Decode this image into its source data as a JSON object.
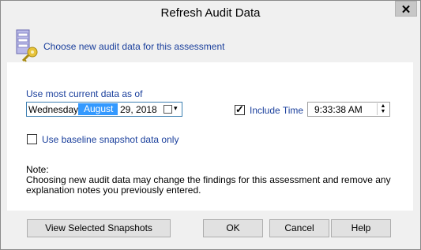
{
  "window": {
    "title": "Refresh Audit Data",
    "close_glyph": "✕"
  },
  "header": {
    "text": "Choose new audit data for this assessment",
    "icon": "database-key-icon"
  },
  "date_section": {
    "label": "Use most current data as of",
    "day": "Wednesday,",
    "month": "August",
    "day_year": "29, 2018",
    "dropdown_glyph": "▾"
  },
  "time_section": {
    "include_label": "Include Time",
    "include_checked": true,
    "value": "9:33:38 AM"
  },
  "baseline": {
    "label": "Use baseline snapshot data only",
    "checked": false
  },
  "note": {
    "heading": "Note:",
    "line1": "Choosing new audit data may change the findings for this assessment and remove any",
    "line2": "explanation notes you previously entered."
  },
  "buttons": {
    "view_snapshots": "View Selected Snapshots",
    "ok": "OK",
    "cancel": "Cancel",
    "help": "Help"
  },
  "colors": {
    "accent": "#1a3f9c",
    "selection": "#3399ff"
  }
}
